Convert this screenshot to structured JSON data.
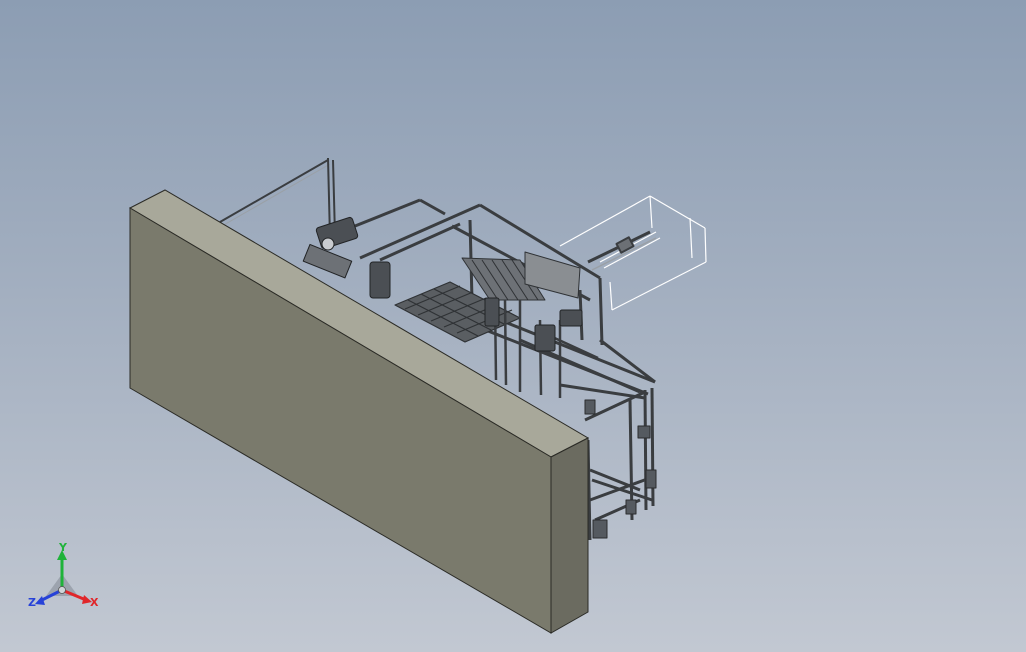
{
  "viewport": {
    "background_top": "#8c9db3",
    "background_bottom": "#c2c8d2"
  },
  "model": {
    "wall_front_color": "#7a7a6c",
    "wall_side_color": "#6b6b60",
    "wall_top_color": "#a8a89a",
    "frame_color": "#3a3d40",
    "frame_highlight": "#9aa0a6"
  },
  "triad": {
    "x_label": "X",
    "y_label": "Y",
    "z_label": "Z",
    "x_color": "#e0262a",
    "y_color": "#1fb33a",
    "z_color": "#2742d8"
  }
}
